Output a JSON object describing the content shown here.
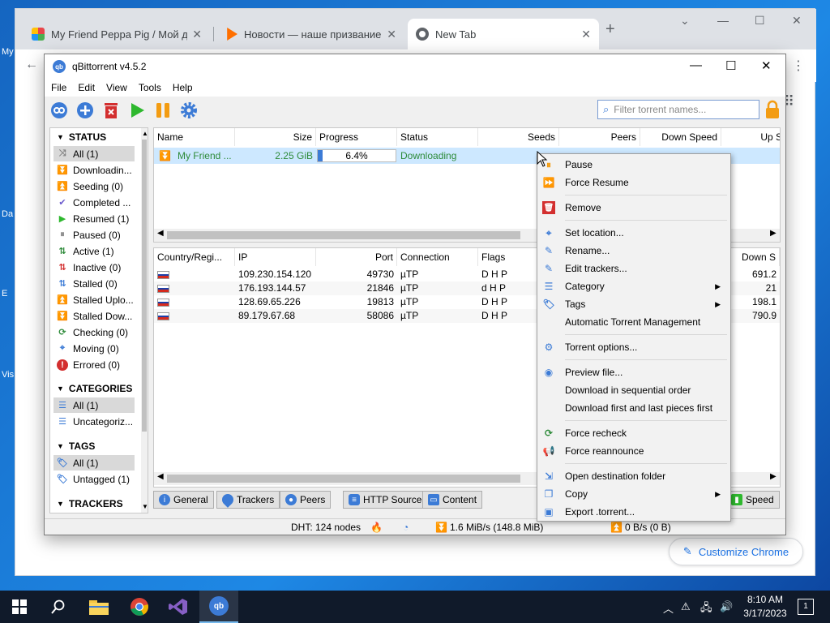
{
  "desktop": {
    "labels": [
      "My",
      "Da",
      "E",
      "Vis"
    ]
  },
  "browser": {
    "tabs": [
      {
        "title": "My Friend Peppa Pig / Мой дру",
        "color": "#e8454a"
      },
      {
        "title": "Новости — наше призвание на",
        "color": "#ff6f00"
      },
      {
        "title": "New Tab",
        "color": "#5f6368"
      }
    ],
    "customize_label": "Customize Chrome"
  },
  "window": {
    "title": "qBittorrent v4.5.2"
  },
  "menu": [
    "File",
    "Edit",
    "View",
    "Tools",
    "Help"
  ],
  "filter": {
    "placeholder": "Filter torrent names..."
  },
  "sidebar": {
    "status_header": "STATUS",
    "status_items": [
      {
        "label": "All (1)",
        "icon": "shuffle-icon",
        "color": "#7f7f7f"
      },
      {
        "label": "Downloadin...",
        "icon": "download-chevrons-icon",
        "color": "#2e8b3a"
      },
      {
        "label": "Seeding (0)",
        "icon": "upload-chevrons-icon",
        "color": "#3c7bd6"
      },
      {
        "label": "Completed ...",
        "icon": "checkmark-icon",
        "color": "#6a5acd"
      },
      {
        "label": "Resumed (1)",
        "icon": "play-icon",
        "color": "#2eb82e"
      },
      {
        "label": "Paused (0)",
        "icon": "pause-icon",
        "color": "#8a8a8a"
      },
      {
        "label": "Active (1)",
        "icon": "active-arrows-icon",
        "color": "#2e8b3a"
      },
      {
        "label": "Inactive (0)",
        "icon": "inactive-arrows-icon",
        "color": "#d32f2f"
      },
      {
        "label": "Stalled (0)",
        "icon": "stalled-arrows-icon",
        "color": "#3c7bd6"
      },
      {
        "label": "Stalled Uplo...",
        "icon": "stalled-upload-icon",
        "color": "#3c7bd6"
      },
      {
        "label": "Stalled Dow...",
        "icon": "stalled-download-icon",
        "color": "#2e8b3a"
      },
      {
        "label": "Checking (0)",
        "icon": "refresh-icon",
        "color": "#2e8b3a"
      },
      {
        "label": "Moving (0)",
        "icon": "crosshair-icon",
        "color": "#3c7bd6"
      },
      {
        "label": "Errored (0)",
        "icon": "error-icon",
        "color": "#d32f2f"
      }
    ],
    "categories_header": "CATEGORIES",
    "category_items": [
      {
        "label": "All (1)",
        "icon": "list-icon",
        "color": "#3c7bd6"
      },
      {
        "label": "Uncategoriz...",
        "icon": "list-icon",
        "color": "#3c7bd6"
      }
    ],
    "tags_header": "TAGS",
    "tag_items": [
      {
        "label": "All (1)",
        "icon": "tag-icon",
        "color": "#3c7bd6"
      },
      {
        "label": "Untagged (1)",
        "icon": "tag-icon",
        "color": "#3c7bd6"
      }
    ],
    "trackers_header": "TRACKERS"
  },
  "torrents": {
    "headers": [
      "Name",
      "Size",
      "Progress",
      "Status",
      "Seeds",
      "Peers",
      "Down Speed",
      "Up S"
    ],
    "row": {
      "name": "My Friend ...",
      "size": "2.25 GiB",
      "progress_text": "6.4%",
      "progress": 0.064,
      "status": "Downloading"
    }
  },
  "peers": {
    "headers": [
      "Country/Regi...",
      "IP",
      "Port",
      "Connection",
      "Flags",
      "Down S"
    ],
    "rows": [
      {
        "ip": "109.230.154.120",
        "port": "49730",
        "connection": "µTP",
        "flags": "D H P",
        "down": "691.2"
      },
      {
        "ip": "176.193.144.57",
        "port": "21846",
        "connection": "µTP",
        "flags": "d H P",
        "down": "21"
      },
      {
        "ip": "128.69.65.226",
        "port": "19813",
        "connection": "µTP",
        "flags": "D H P",
        "down": "198.1"
      },
      {
        "ip": "89.179.67.68",
        "port": "58086",
        "connection": "µTP",
        "flags": "D H P",
        "down": "790.9"
      }
    ]
  },
  "detail_tabs": [
    "General",
    "Trackers",
    "Peers",
    "HTTP Sources",
    "Content",
    "Speed"
  ],
  "statusbar": {
    "dht": "DHT: 124 nodes",
    "down": "1.6 MiB/s (148.8 MiB)",
    "up": "0 B/s (0 B)"
  },
  "context_menu": [
    {
      "label": "Pause",
      "icon": "pause-icon",
      "color": "#f39c12"
    },
    {
      "label": "Force Resume",
      "icon": "force-resume-icon",
      "color": "#2eb82e"
    },
    {
      "sep": true
    },
    {
      "label": "Remove",
      "icon": "remove-icon",
      "color": "#d32f2f"
    },
    {
      "sep": true
    },
    {
      "label": "Set location...",
      "icon": "crosshair-icon",
      "color": "#3c7bd6"
    },
    {
      "label": "Rename...",
      "icon": "pencil-icon",
      "color": "#3c7bd6"
    },
    {
      "label": "Edit trackers...",
      "icon": "pencil-icon",
      "color": "#3c7bd6"
    },
    {
      "label": "Category",
      "icon": "list-icon",
      "color": "#3c7bd6",
      "submenu": true
    },
    {
      "label": "Tags",
      "icon": "tag-icon",
      "color": "#3c7bd6",
      "submenu": true
    },
    {
      "label": "Automatic Torrent Management",
      "icon": "",
      "color": ""
    },
    {
      "sep": true
    },
    {
      "label": "Torrent options...",
      "icon": "gear-icon",
      "color": "#3c7bd6"
    },
    {
      "sep": true
    },
    {
      "label": "Preview file...",
      "icon": "eye-icon",
      "color": "#3c7bd6"
    },
    {
      "label": "Download in sequential order",
      "icon": "",
      "color": ""
    },
    {
      "label": "Download first and last pieces first",
      "icon": "",
      "color": ""
    },
    {
      "sep": true
    },
    {
      "label": "Force recheck",
      "icon": "refresh-icon",
      "color": "#2e8b3a"
    },
    {
      "label": "Force reannounce",
      "icon": "megaphone-icon",
      "color": "#2eb82e"
    },
    {
      "sep": true
    },
    {
      "label": "Open destination folder",
      "icon": "open-folder-icon",
      "color": "#3c7bd6"
    },
    {
      "label": "Copy",
      "icon": "copy-icon",
      "color": "#3c7bd6",
      "submenu": true
    },
    {
      "label": "Export .torrent...",
      "icon": "export-icon",
      "color": "#3c7bd6"
    }
  ],
  "taskbar": {
    "time": "8:10 AM",
    "date": "3/17/2023",
    "notifications": "1"
  }
}
